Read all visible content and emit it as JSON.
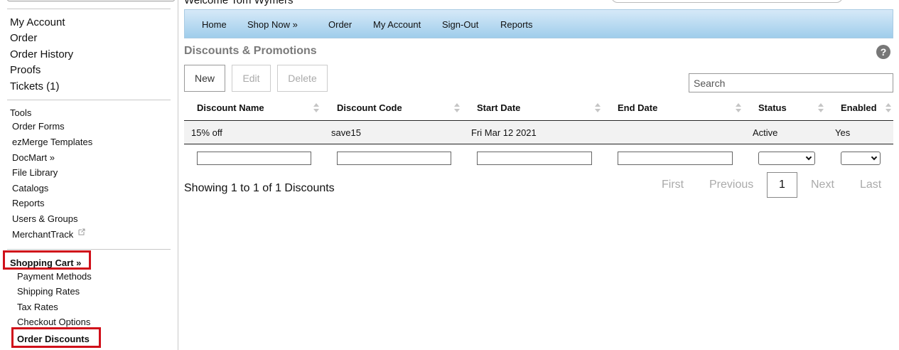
{
  "header": {
    "welcome": "Welcome Tom Wymers"
  },
  "nav": {
    "items": [
      "Home",
      "Shop Now »",
      "Order",
      "My Account",
      "Sign-Out",
      "Reports"
    ]
  },
  "sidebar": {
    "account_items": [
      "My Account",
      "Order",
      "Order History",
      "Proofs",
      "Tickets (1)"
    ],
    "tools_label": "Tools",
    "tools_items": [
      "Order Forms",
      "ezMerge Templates",
      "DocMart »",
      "File Library",
      "Catalogs",
      "Reports",
      "Users & Groups",
      "MerchantTrack"
    ],
    "cart_label": "Shopping Cart »",
    "cart_items": [
      "Payment Methods",
      "Shipping Rates",
      "Tax Rates",
      "Checkout Options"
    ],
    "cart_active": "Order Discounts"
  },
  "main": {
    "title": "Discounts & Promotions",
    "help": "?",
    "buttons": {
      "new": "New",
      "edit": "Edit",
      "delete": "Delete"
    },
    "search_placeholder": "Search",
    "columns": [
      "Discount Name",
      "Discount Code",
      "Start Date",
      "End Date",
      "Status",
      "Enabled"
    ],
    "rows": [
      {
        "name": "15% off",
        "code": "save15",
        "start": "Fri Mar 12 2021",
        "end": "",
        "status": "Active",
        "enabled": "Yes"
      }
    ],
    "showing": "Showing 1 to 1 of 1 Discounts",
    "pagination": {
      "first": "First",
      "previous": "Previous",
      "current": "1",
      "next": "Next",
      "last": "Last"
    }
  },
  "colors": {
    "highlight": "#d0101a",
    "nav_top": "#d6e9f8",
    "nav_bottom": "#9fcdeb"
  }
}
